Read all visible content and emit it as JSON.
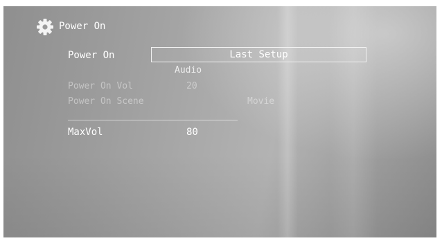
{
  "menu": {
    "title": "Power On",
    "icon": "gear-icon"
  },
  "power_on": {
    "label": "Power On",
    "selected_value": "Last Setup",
    "sub_option": "Audio"
  },
  "power_on_vol": {
    "label": "Power On Vol",
    "value": "20"
  },
  "power_on_scene": {
    "label": "Power On Scene",
    "value": "Movie"
  },
  "max_vol": {
    "label": "MaxVol",
    "value": "80"
  }
}
